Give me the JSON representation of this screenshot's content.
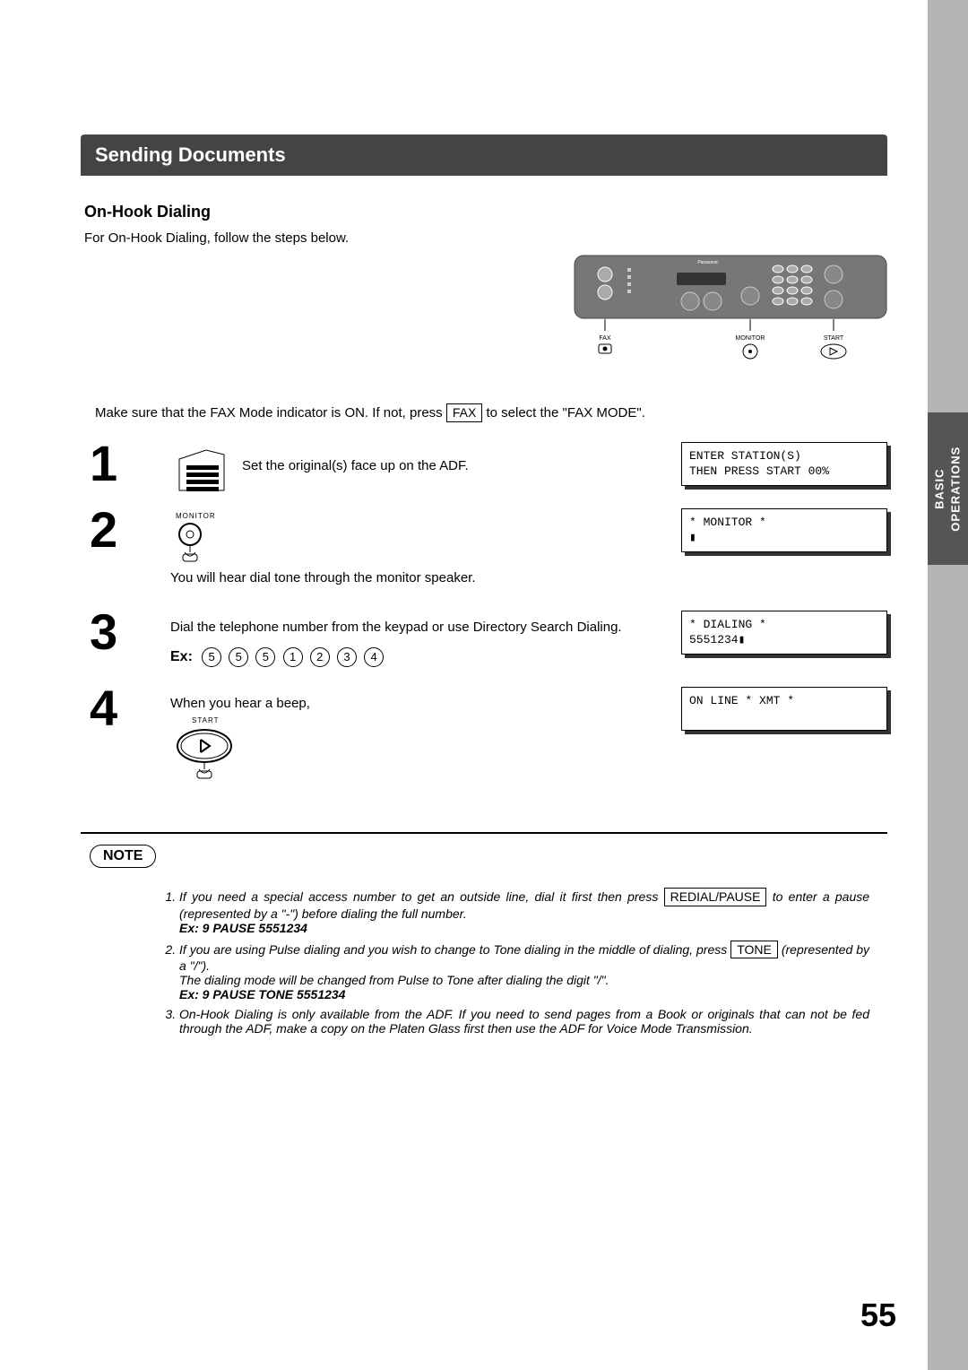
{
  "title_bar": "Sending Documents",
  "subtitle": "On-Hook Dialing",
  "intro": "For On-Hook Dialing, follow the steps below.",
  "side_tab_l1": "BASIC",
  "side_tab_l2": "OPERATIONS",
  "panel": {
    "brand": "Panasonic",
    "fax_label": "FAX",
    "monitor_label": "MONITOR",
    "start_label": "START"
  },
  "pre_step": {
    "pre": "Make sure that the FAX Mode indicator is ON.  If not, press ",
    "button": "FAX",
    "post": " to select the \"FAX MODE\"."
  },
  "steps": {
    "s1": {
      "num": "1",
      "text": "Set the original(s) face up on the ADF.",
      "lcd": "ENTER STATION(S)\nTHEN PRESS START 00%"
    },
    "s2": {
      "num": "2",
      "icon_label": "MONITOR",
      "text": "You will hear dial tone through the monitor speaker.",
      "lcd": "* MONITOR *\n▮"
    },
    "s3": {
      "num": "3",
      "text": "Dial the telephone number from the keypad or use Directory Search Dialing.",
      "ex_label": "Ex:",
      "digits": [
        "5",
        "5",
        "5",
        "1",
        "2",
        "3",
        "4"
      ],
      "lcd": "* DIALING *\n5551234▮"
    },
    "s4": {
      "num": "4",
      "text": "When you hear a beep,",
      "icon_label": "START",
      "lcd": "ON LINE * XMT *\n "
    }
  },
  "note": {
    "label": "NOTE",
    "n1_pre": "If you need a special access number to get an outside line, dial it first then press ",
    "n1_button": "REDIAL/PAUSE",
    "n1_post": " to enter a pause (represented by a \"-\") before dialing the full number.",
    "n1_ex": "Ex: 9 PAUSE 5551234",
    "n2_pre": "If you are using Pulse dialing and you wish to change to Tone dialing in the middle of dialing, press ",
    "n2_button": "TONE",
    "n2_post": " (represented by a \"/\").",
    "n2_line2": "The dialing mode will be changed from Pulse to Tone after dialing the digit \"/\".",
    "n2_ex": "Ex: 9 PAUSE TONE 5551234",
    "n3": "On-Hook Dialing is only available from the ADF.  If you need to send pages from a Book or originals that can not be fed through the ADF, make a copy on the Platen Glass first then use the ADF for Voice Mode Transmission."
  },
  "page_num": "55"
}
